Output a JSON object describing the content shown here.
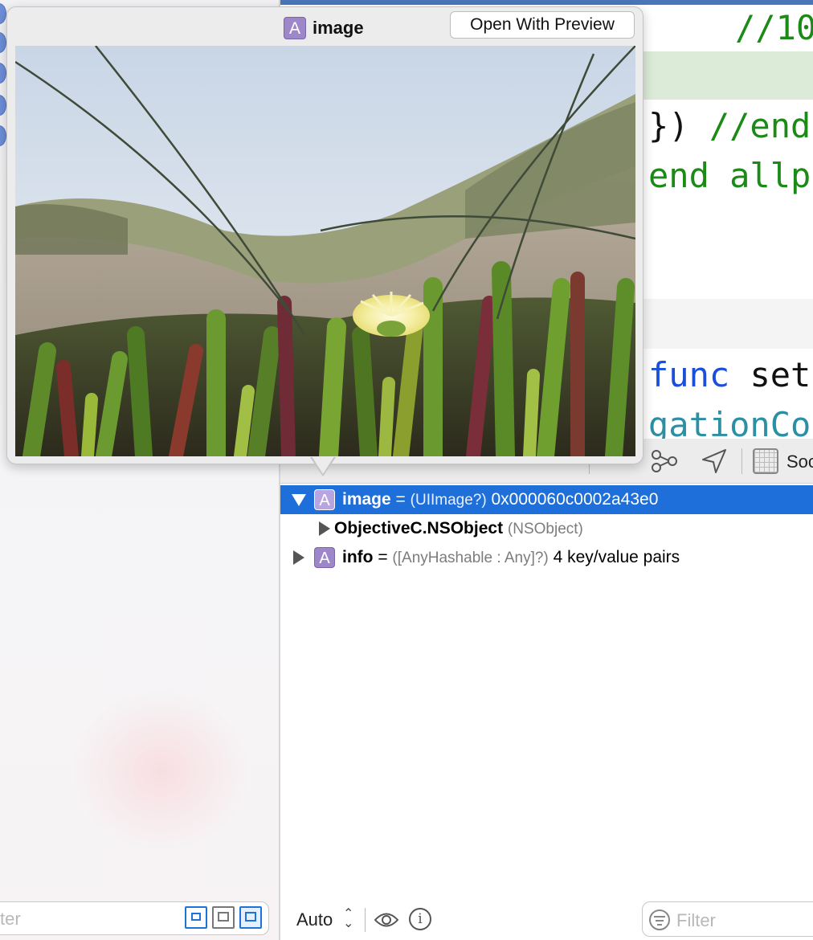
{
  "popover": {
    "title": "image",
    "badge": "A",
    "open_button": "Open With Preview",
    "preview_image": "photo-of-yellow-iceplant-flower-on-dunes"
  },
  "editor": {
    "lines": [
      {
        "text": "//10",
        "color": "green"
      },
      {
        "text": "}) //end",
        "color": "mixed"
      },
      {
        "text": "end allp",
        "color": "green"
      },
      {
        "text_kw": "func",
        "text_rest": " set",
        "color": "blue"
      },
      {
        "text": "gationCo",
        "color": "teal"
      }
    ]
  },
  "debugbar": {
    "scheme_label": "Soc"
  },
  "variables": [
    {
      "name": "image",
      "eq": " = ",
      "type": "(UIImage?)",
      "value": " 0x000060c0002a43e0",
      "expanded": true,
      "selected": true,
      "badge": "A"
    },
    {
      "name": "ObjectiveC.NSObject",
      "eq": " ",
      "type": "(NSObject)",
      "value": "",
      "expanded": false,
      "selected": false,
      "badge": ""
    },
    {
      "name": "info",
      "eq": " = ",
      "type": "([AnyHashable : Any]?)",
      "value": " 4 key/value pairs",
      "expanded": false,
      "selected": false,
      "badge": "A"
    }
  ],
  "bottombar": {
    "auto_label": "Auto",
    "info_glyph": "i",
    "filter_placeholder": "Filter"
  },
  "sidebar": {
    "filter_placeholder": "ter"
  },
  "colors": {
    "selection": "#1e6fd9",
    "accent": "#1e74d6",
    "badge": "#9d87c9",
    "comment_green": "#1b8a16",
    "keyword_blue": "#1b4fd9"
  }
}
